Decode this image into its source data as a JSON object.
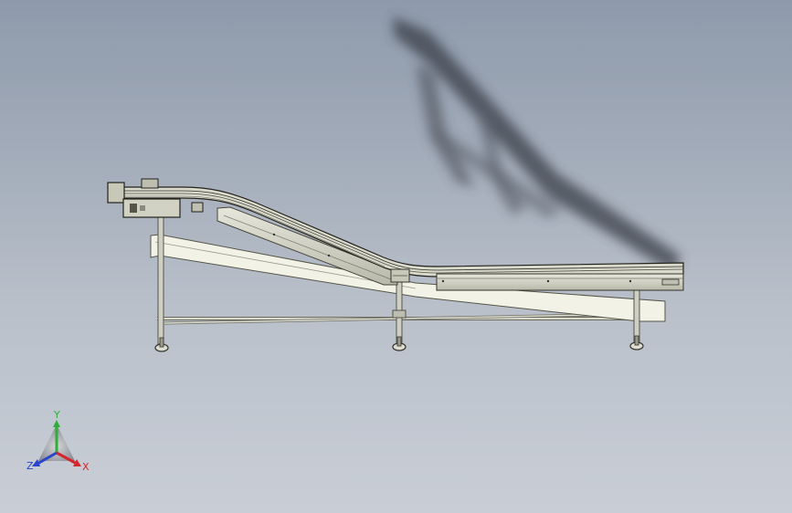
{
  "triad": {
    "x_label": "X",
    "y_label": "Y",
    "z_label": "Z",
    "x_color": "#d8242b",
    "y_color": "#2fae3a",
    "z_color": "#2a45c8"
  },
  "colors": {
    "background_top": "#8e9aab",
    "background_bottom": "#c9ced6",
    "frame_metal": "#c8c8b8",
    "slide_rail": "#f2f2e6",
    "shadow": "#3a3f48"
  },
  "icons": {
    "drive_motor": "motor-icon",
    "support_legs": "leg-icon",
    "view_triad": "axis-triad-icon"
  }
}
